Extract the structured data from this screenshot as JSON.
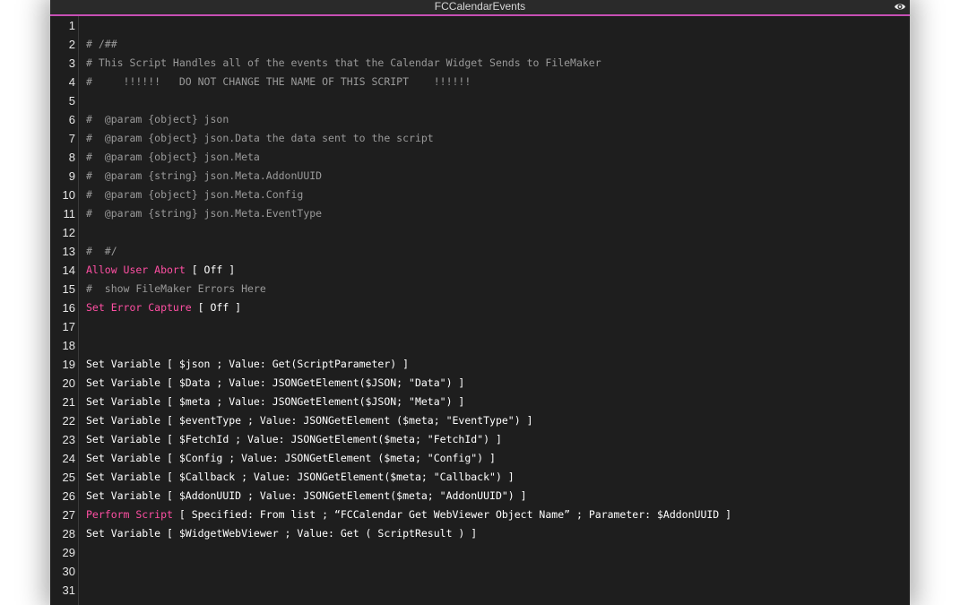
{
  "window": {
    "title": "FCCalendarEvents",
    "accent_color": "#c64fb4"
  },
  "icons": {
    "preview": "eye-icon"
  },
  "lines": [
    {
      "n": "1",
      "type": "blank",
      "text": ""
    },
    {
      "n": "2",
      "type": "comment",
      "text": "# /##"
    },
    {
      "n": "3",
      "type": "comment",
      "text": "# This Script Handles all of the events that the Calendar Widget Sends to FileMaker"
    },
    {
      "n": "4",
      "type": "comment",
      "text": "#     !!!!!!   DO NOT CHANGE THE NAME OF THIS SCRIPT    !!!!!!"
    },
    {
      "n": "5",
      "type": "blank",
      "text": ""
    },
    {
      "n": "6",
      "type": "comment",
      "text": "#  @param {object} json"
    },
    {
      "n": "7",
      "type": "comment",
      "text": "#  @param {object} json.Data the data sent to the script"
    },
    {
      "n": "8",
      "type": "comment",
      "text": "#  @param {object} json.Meta"
    },
    {
      "n": "9",
      "type": "comment",
      "text": "#  @param {string} json.Meta.AddonUUID"
    },
    {
      "n": "10",
      "type": "comment",
      "text": "#  @param {object} json.Meta.Config"
    },
    {
      "n": "11",
      "type": "comment",
      "text": "#  @param {string} json.Meta.EventType"
    },
    {
      "n": "12",
      "type": "blank",
      "text": ""
    },
    {
      "n": "13",
      "type": "comment",
      "text": "#  #/"
    },
    {
      "n": "14",
      "type": "control",
      "keyword": "Allow User Abort",
      "text": " [ Off ]"
    },
    {
      "n": "15",
      "type": "comment",
      "text": "#  show FileMaker Errors Here"
    },
    {
      "n": "16",
      "type": "control",
      "keyword": "Set Error Capture",
      "text": " [ Off ]"
    },
    {
      "n": "17",
      "type": "blank",
      "text": ""
    },
    {
      "n": "18",
      "type": "blank",
      "text": ""
    },
    {
      "n": "19",
      "type": "step",
      "text": "Set Variable [ $json ; Value: Get(ScriptParameter) ]"
    },
    {
      "n": "20",
      "type": "step",
      "text": "Set Variable [ $Data ; Value: JSONGetElement($JSON; \"Data\") ]"
    },
    {
      "n": "21",
      "type": "step",
      "text": "Set Variable [ $meta ; Value: JSONGetElement($JSON; \"Meta\") ]"
    },
    {
      "n": "22",
      "type": "step",
      "text": "Set Variable [ $eventType ; Value: JSONGetElement ($meta; \"EventType\") ]"
    },
    {
      "n": "23",
      "type": "step",
      "text": "Set Variable [ $FetchId ; Value: JSONGetElement($meta; \"FetchId\") ]"
    },
    {
      "n": "24",
      "type": "step",
      "text": "Set Variable [ $Config ; Value: JSONGetElement ($meta; \"Config\") ]"
    },
    {
      "n": "25",
      "type": "step",
      "text": "Set Variable [ $Callback ; Value: JSONGetElement($meta; \"Callback\") ]"
    },
    {
      "n": "26",
      "type": "step",
      "text": "Set Variable [ $AddonUUID ; Value: JSONGetElement($meta; \"AddonUUID\") ]"
    },
    {
      "n": "27",
      "type": "control",
      "keyword": "Perform Script",
      "text": " [ Specified: From list ; “FCCalendar Get WebViewer Object Name” ; Parameter: $AddonUUID ]"
    },
    {
      "n": "28",
      "type": "step",
      "text": "Set Variable [ $WidgetWebViewer ; Value: Get ( ScriptResult ) ]"
    },
    {
      "n": "29",
      "type": "blank",
      "text": ""
    },
    {
      "n": "30",
      "type": "blank",
      "text": ""
    },
    {
      "n": "31",
      "type": "blank",
      "text": ""
    }
  ]
}
